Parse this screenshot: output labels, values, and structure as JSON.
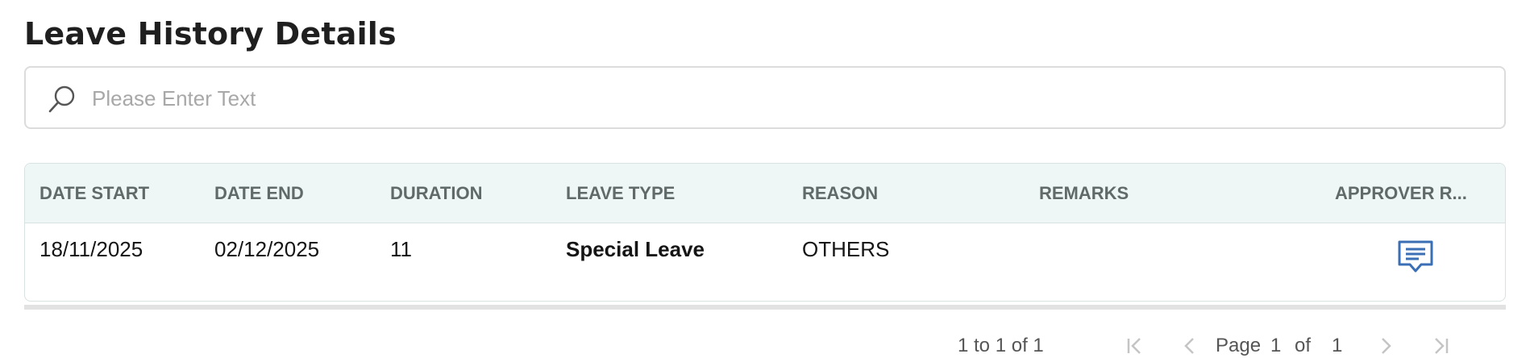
{
  "page": {
    "title": "Leave History Details"
  },
  "search": {
    "placeholder": "Please Enter Text",
    "icon": "search-icon"
  },
  "table": {
    "columns": [
      "DATE START",
      "DATE END",
      "DURATION",
      "LEAVE TYPE",
      "REASON",
      "REMARKS",
      "APPROVER R..."
    ],
    "rows": [
      {
        "date_start": "18/11/2025",
        "date_end": "02/12/2025",
        "duration": "11",
        "leave_type": "Special Leave",
        "reason": "OTHERS",
        "remarks": "",
        "approver_remarks_icon": "comment-icon"
      }
    ]
  },
  "pagination": {
    "summary": "1 to 1 of 1",
    "page_label": "Page",
    "current_page": "1",
    "of_label": "of",
    "total_pages": "1"
  },
  "colors": {
    "header_bg": "#eef7f5",
    "header_text": "#5f6a69",
    "icon_blue": "#3a6fb5",
    "border": "#dcdcdc"
  }
}
